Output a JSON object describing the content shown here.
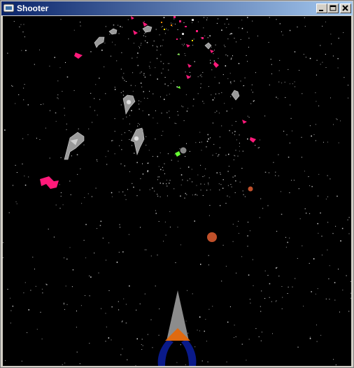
{
  "window": {
    "title": "Shooter",
    "controls": {
      "minimize": "minimize",
      "maximize": "maximize",
      "close": "close"
    }
  },
  "colors": {
    "background": "#000000",
    "enemy_ship": "#9a9a9a",
    "debris": "#ff1a7a",
    "player_nose": "#8c8c8c",
    "player_cockpit": "#e06a10",
    "player_wings": "#0a1a8a",
    "planet": "#c0502a"
  },
  "icons": [
    "app-icon",
    "minimize-icon",
    "maximize-icon",
    "close-icon"
  ]
}
